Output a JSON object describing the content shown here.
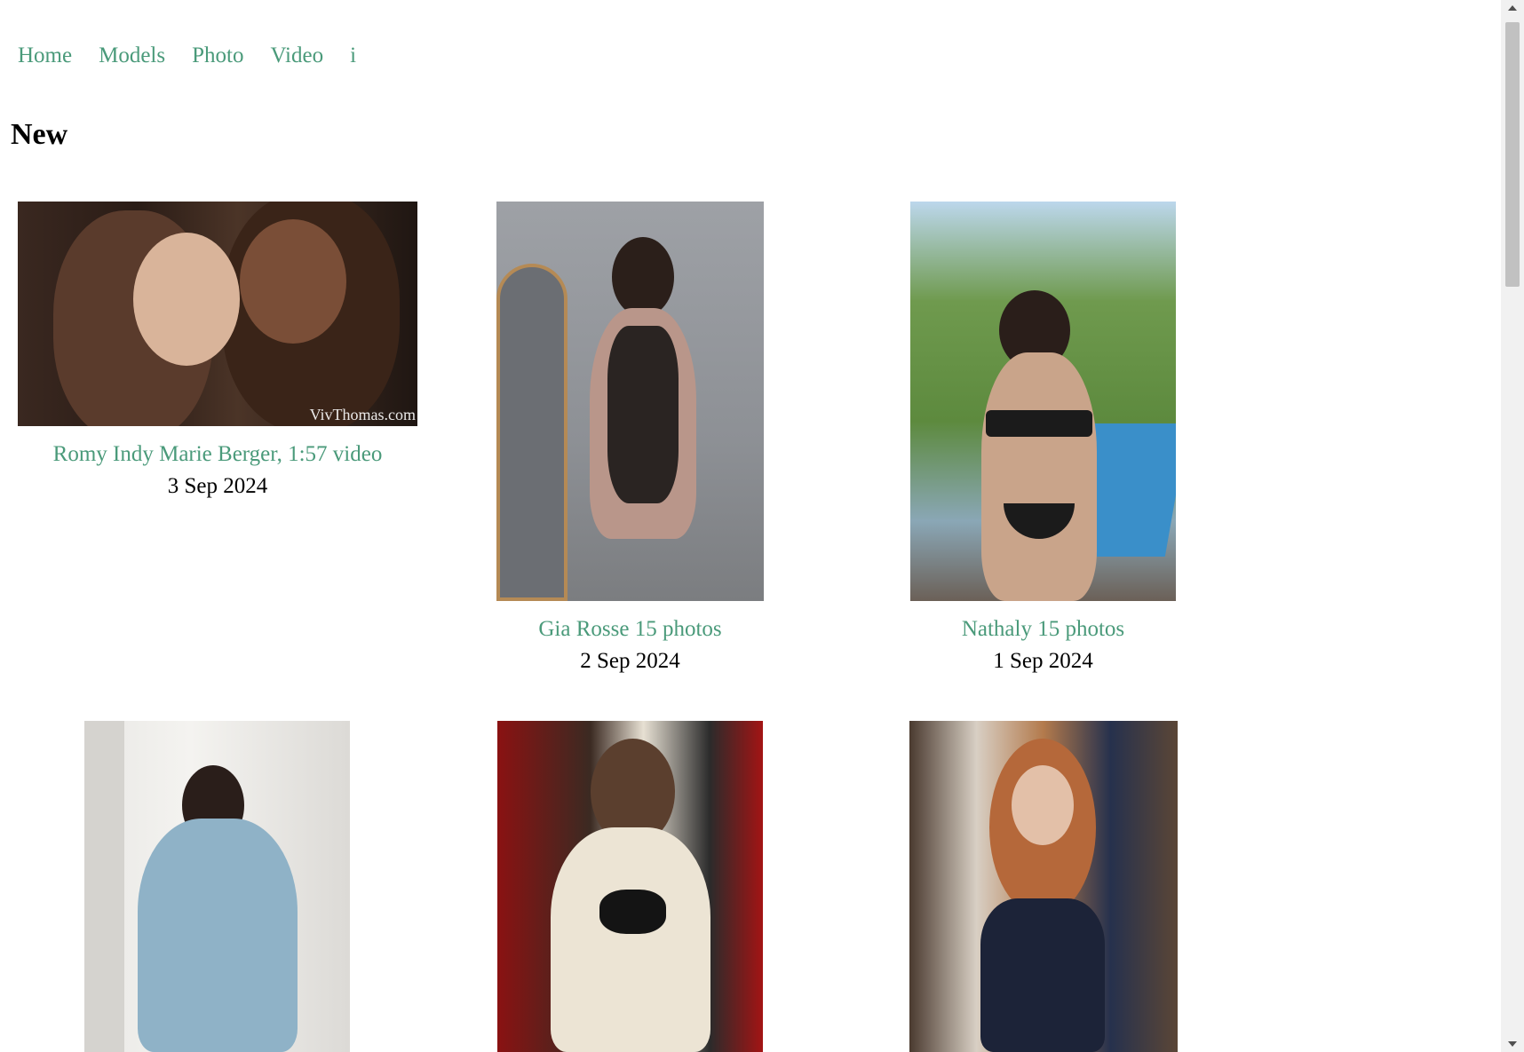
{
  "nav": {
    "items": [
      {
        "label": "Home"
      },
      {
        "label": "Models"
      },
      {
        "label": "Photo"
      },
      {
        "label": "Video"
      },
      {
        "label": "i"
      }
    ]
  },
  "section": {
    "title": "New"
  },
  "cards": [
    {
      "caption": "Romy Indy Marie Berger, 1:57 video",
      "date": "3 Sep 2024",
      "watermark": "VivThomas.com"
    },
    {
      "caption": "Gia Rosse 15 photos",
      "date": "2 Sep 2024"
    },
    {
      "caption": "Nathaly 15 photos",
      "date": "1 Sep 2024"
    },
    {},
    {},
    {}
  ],
  "colors": {
    "link": "#4a9a7a",
    "text": "#000000",
    "background": "#ffffff"
  }
}
